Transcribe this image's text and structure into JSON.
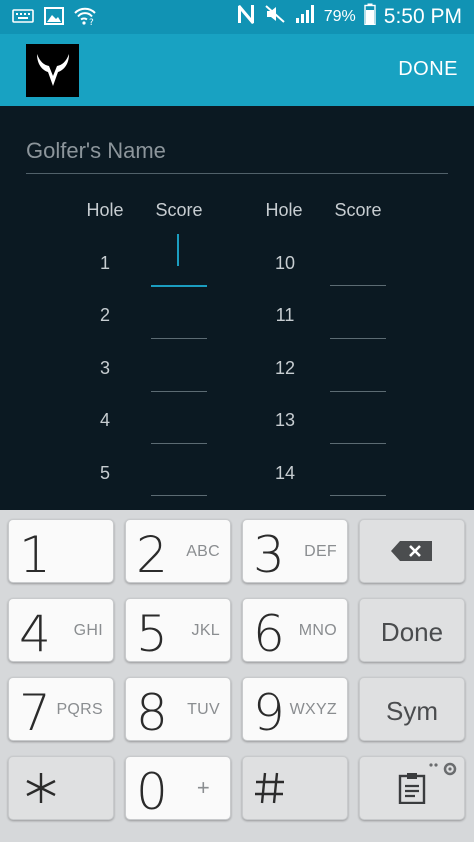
{
  "status_bar": {
    "battery_percent": "79%",
    "time": "5:50 PM",
    "left_icons": [
      "keyboard-icon",
      "image-icon",
      "wifi-question-icon"
    ],
    "right_icons": [
      "n-icon",
      "mute-icon",
      "signal-icon",
      "battery-icon"
    ]
  },
  "app_bar": {
    "logo": "horned-logo-icon",
    "done_label": "DONE",
    "color": "#18a2c2"
  },
  "form": {
    "name_placeholder": "Golfer's Name",
    "left_headers": {
      "hole": "Hole",
      "score": "Score"
    },
    "right_headers": {
      "hole": "Hole",
      "score": "Score"
    },
    "left_holes": [
      "1",
      "2",
      "3",
      "4",
      "5"
    ],
    "right_holes": [
      "10",
      "11",
      "12",
      "13",
      "14"
    ],
    "active_score": "hole-1"
  },
  "keypad": {
    "keys": [
      {
        "digit": "1",
        "letters": ""
      },
      {
        "digit": "2",
        "letters": "ABC"
      },
      {
        "digit": "3",
        "letters": "DEF"
      },
      {
        "icon": "backspace-icon"
      },
      {
        "digit": "4",
        "letters": "GHI"
      },
      {
        "digit": "5",
        "letters": "JKL"
      },
      {
        "digit": "6",
        "letters": "MNO"
      },
      {
        "label": "Done"
      },
      {
        "digit": "7",
        "letters": "PQRS"
      },
      {
        "digit": "8",
        "letters": "TUV"
      },
      {
        "digit": "9",
        "letters": "WXYZ"
      },
      {
        "label": "Sym"
      },
      {
        "icon": "asterisk-icon"
      },
      {
        "digit": "0",
        "letters": "+"
      },
      {
        "icon": "hash-icon"
      },
      {
        "icon": "clipboard-icon"
      }
    ]
  }
}
